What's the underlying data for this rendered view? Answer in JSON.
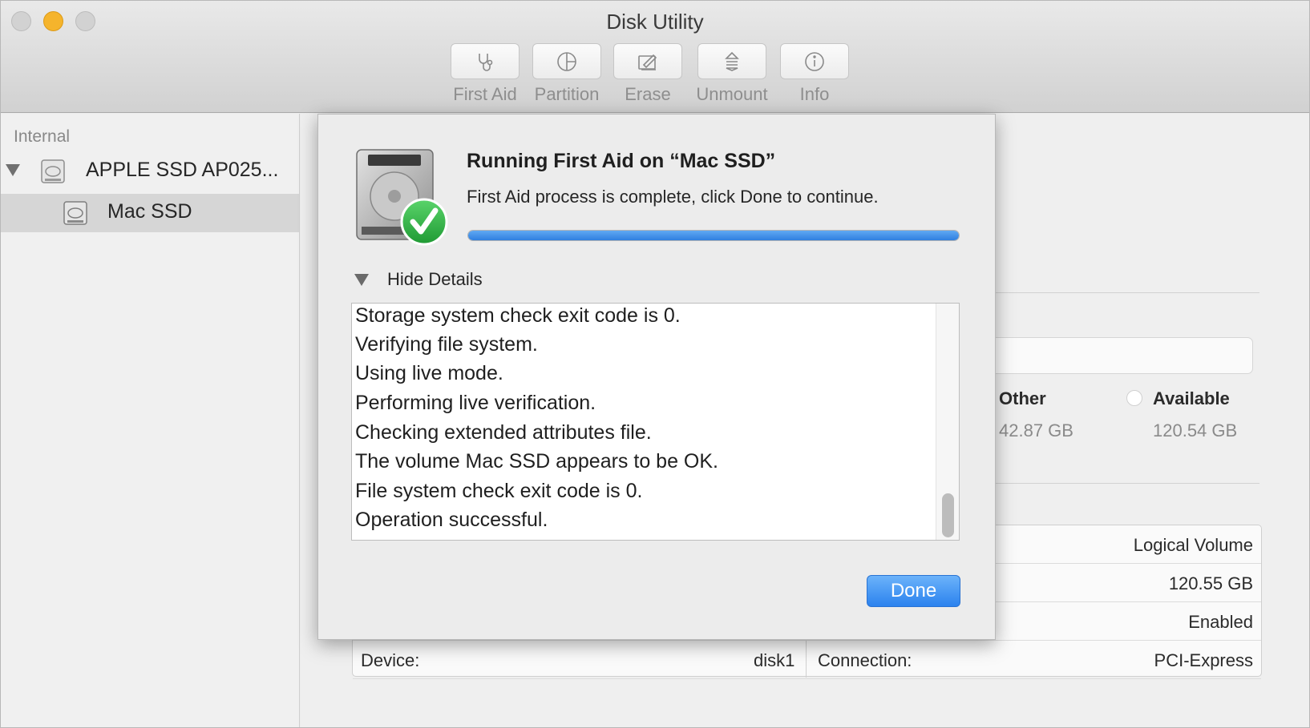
{
  "window": {
    "title": "Disk Utility"
  },
  "toolbar": {
    "buttons": [
      {
        "label": "First Aid",
        "icon": "stethoscope-icon"
      },
      {
        "label": "Partition",
        "icon": "partition-pie-icon"
      },
      {
        "label": "Erase",
        "icon": "erase-icon"
      },
      {
        "label": "Unmount",
        "icon": "unmount-icon"
      },
      {
        "label": "Info",
        "icon": "info-icon"
      }
    ]
  },
  "sidebar": {
    "section": "Internal",
    "disk": "APPLE SSD AP025...",
    "volume": "Mac SSD"
  },
  "main": {
    "legend": [
      {
        "name": "Other",
        "value": "42.87 GB"
      },
      {
        "name": "Available",
        "value": "120.54 GB"
      }
    ],
    "info": {
      "row1_value": "Logical Volume",
      "row2_value": "120.55 GB",
      "row3_value": "Enabled",
      "device_label": "Device:",
      "device_value": "disk1",
      "connection_label": "Connection:",
      "connection_value": "PCI-Express"
    }
  },
  "sheet": {
    "title": "Running First Aid on “Mac SSD”",
    "message": "First Aid process is complete, click Done to continue.",
    "progress": 1.0,
    "details_toggle": "Hide Details",
    "log_lines": [
      "Storage system check exit code is 0.",
      "Verifying file system.",
      "Using live mode.",
      "Performing live verification.",
      "Checking extended attributes file.",
      "The volume Mac SSD appears to be OK.",
      "File system check exit code is 0.",
      "Operation successful."
    ],
    "done_label": "Done"
  },
  "colors": {
    "accent": "#2b82ee",
    "success": "#2bb24c",
    "minimize": "#f5b42c"
  }
}
